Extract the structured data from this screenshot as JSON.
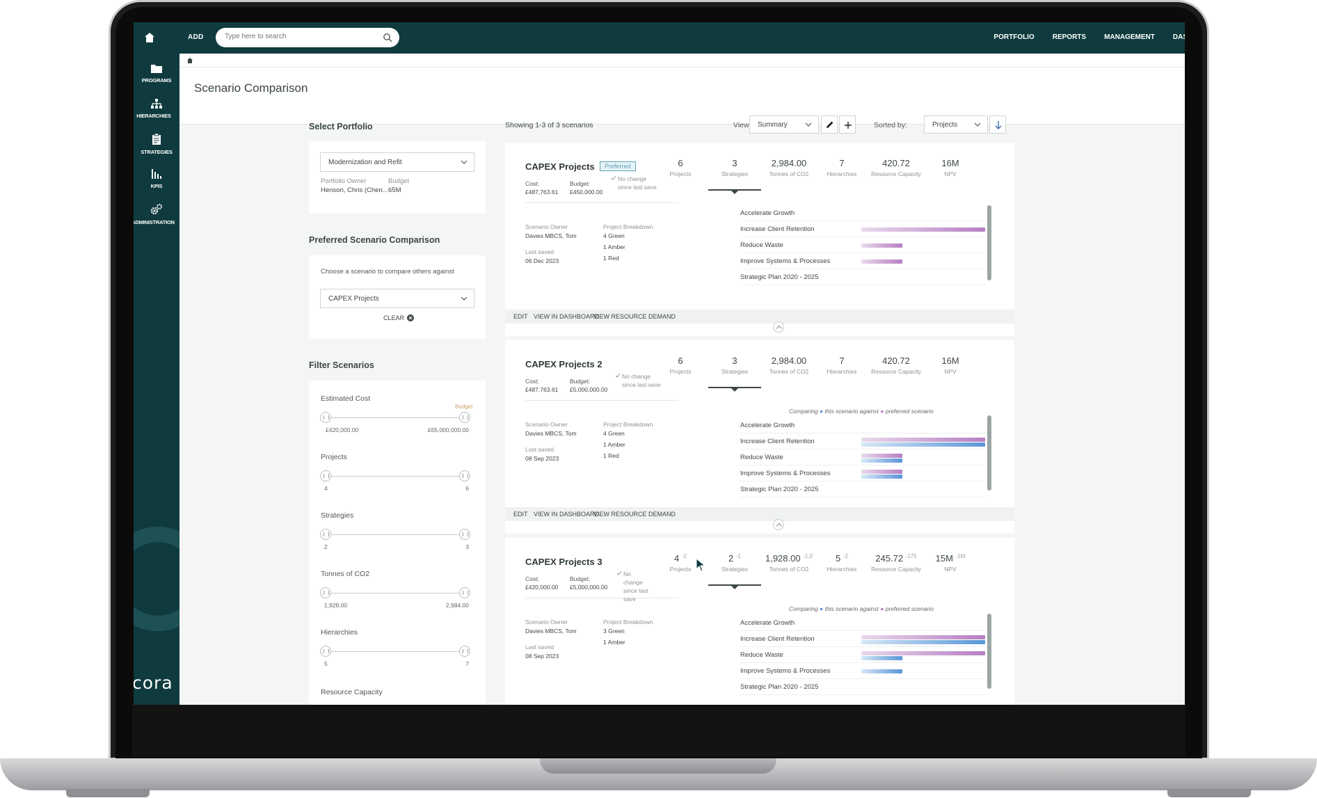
{
  "topbar": {
    "add_label": "ADD",
    "search_placeholder": "Type here to search",
    "nav": [
      "PORTFOLIO",
      "REPORTS",
      "MANAGEMENT",
      "DAS"
    ]
  },
  "sidebar": {
    "items": [
      "PROGRAMS",
      "HIERARCHIES",
      "STRATEGIES",
      "KPIS",
      "ADMINISTRATION"
    ],
    "logo": "cora"
  },
  "page": {
    "title": "Scenario Comparison"
  },
  "select_portfolio": {
    "title": "Select Portfolio",
    "portfolio": "Modernization and Refit",
    "owner_label": "Portfolio Owner",
    "owner_value": "Henson, Chris (Chen...",
    "budget_label": "Budget",
    "budget_value": "65M"
  },
  "preferred": {
    "title": "Preferred Scenario Comparison",
    "hint": "Choose a scenario to compare others against",
    "selected": "CAPEX Projects",
    "clear_label": "CLEAR"
  },
  "filters": {
    "title": "Filter Scenarios",
    "budget_tag": "Budget",
    "sliders": [
      {
        "label": "Estimated Cost",
        "min": "£420,000.00",
        "max": "£65,000,000.00"
      },
      {
        "label": "Projects",
        "min": "4",
        "max": "6"
      },
      {
        "label": "Strategies",
        "min": "2",
        "max": "3"
      },
      {
        "label": "Tonnes of CO2",
        "min": "1,928.00",
        "max": "2,984.00"
      },
      {
        "label": "Hierarchies",
        "min": "5",
        "max": "7"
      },
      {
        "label": "Resource Capacity",
        "min": "",
        "max": ""
      }
    ]
  },
  "toolbar": {
    "showing": "Showing 1-3 of 3 scenarios",
    "view_label": "View:",
    "view_value": "Summary",
    "sorted_label": "Sorted by:",
    "sorted_value": "Projects"
  },
  "kpi_labels": [
    "Projects",
    "Strategies",
    "Tonnes of CO2",
    "Hierarchies",
    "Resource Capacity",
    "NPV"
  ],
  "card_labels": {
    "cost": "Cost:",
    "budget": "Budget:",
    "owner": "Scenario Owner",
    "breakdown": "Project Breakdown",
    "last_saved": "Last saved",
    "nochange": "No change since last save",
    "comparing": "Comparing",
    "this_scenario": "this scenario against",
    "preferred_scenario": "preferred scenario",
    "edit": "EDIT",
    "dashboard": "VIEW IN DASHBOARD",
    "resource": "VIEW RESOURCE DEMAND",
    "preferred_badge": "Preferred"
  },
  "strategy_names": [
    "Accelerate Growth",
    "Increase Client Retention",
    "Reduce Waste",
    "Improve Systems & Processes",
    "Strategic Plan 2020 - 2025"
  ],
  "scenarios": [
    {
      "name": "CAPEX Projects",
      "cost": "£487,763.61",
      "budget": "£450,000.00",
      "kpis": [
        "6",
        "3",
        "2,984.00",
        "7",
        "420.72",
        "16M"
      ],
      "deltas": [
        "",
        "",
        "",
        "",
        "",
        ""
      ],
      "owner": "Davies MBCS, Tom",
      "saved": "06 Dec 2023",
      "breakdown": [
        "4 Green",
        "1 Amber",
        "1 Red"
      ],
      "strategy_pref": [
        0,
        1.0,
        0.33,
        0.33,
        0
      ],
      "strategy_cur": [
        0,
        0,
        0,
        0,
        0
      ]
    },
    {
      "name": "CAPEX Projects 2",
      "cost": "£487,763.61",
      "budget": "£5,000,000.00",
      "kpis": [
        "6",
        "3",
        "2,984.00",
        "7",
        "420.72",
        "16M"
      ],
      "deltas": [
        "",
        "",
        "",
        "",
        "",
        ""
      ],
      "owner": "Davies MBCS, Tom",
      "saved": "08 Sep 2023",
      "breakdown": [
        "4 Green",
        "1 Amber",
        "1 Red"
      ],
      "strategy_pref": [
        0,
        1.0,
        0.33,
        0.33,
        0
      ],
      "strategy_cur": [
        0,
        1.0,
        0.33,
        0.33,
        0
      ]
    },
    {
      "name": "CAPEX Projects 3",
      "cost": "£420,000.00",
      "budget": "£5,000,000.00",
      "kpis": [
        "4",
        "2",
        "1,928.00",
        "5",
        "245.72",
        "15M"
      ],
      "deltas": [
        "-2",
        "-1",
        "-1,0",
        "-2",
        "-175",
        "-1M"
      ],
      "owner": "Davies MBCS, Tom",
      "saved": "08 Sep 2023",
      "breakdown": [
        "3 Green",
        "1 Amber"
      ],
      "strategy_pref": [
        0,
        1.0,
        1.0,
        0,
        0
      ],
      "strategy_cur": [
        0,
        1.0,
        0.33,
        0.33,
        0
      ]
    }
  ]
}
